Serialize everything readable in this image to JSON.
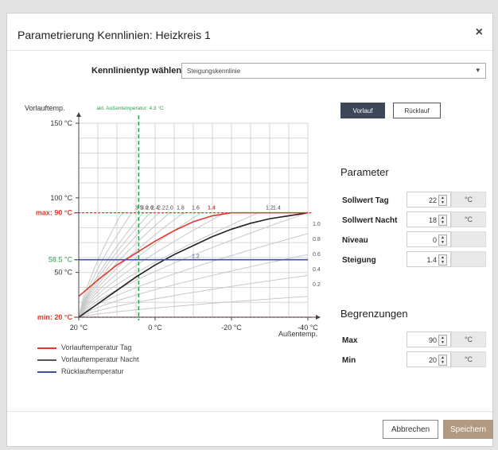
{
  "dialog": {
    "title": "Parametrierung Kennlinien: Heizkreis 1",
    "close_glyph": "×"
  },
  "curve_type": {
    "label": "Kennlinientyp wählen",
    "selected": "Steigungskennlinie"
  },
  "mode_buttons": {
    "vorlauf": "Vorlauf",
    "ruecklauf": "Rücklauf",
    "active": "vorlauf"
  },
  "parameters": {
    "title": "Parameter",
    "rows": [
      {
        "label": "Sollwert Tag",
        "value": "22",
        "unit": "°C"
      },
      {
        "label": "Sollwert Nacht",
        "value": "18",
        "unit": "°C"
      },
      {
        "label": "Niveau",
        "value": "0",
        "unit": ""
      },
      {
        "label": "Steigung",
        "value": "1.4",
        "unit": ""
      }
    ]
  },
  "limits": {
    "title": "Begrenzungen",
    "rows": [
      {
        "label": "Max",
        "value": "90",
        "unit": "°C"
      },
      {
        "label": "Min",
        "value": "20",
        "unit": "°C"
      }
    ]
  },
  "footer": {
    "cancel": "Abbrechen",
    "save": "Speichern"
  },
  "legend": [
    {
      "label": "Vorlauftemperatur Tag",
      "color": "#e03a2c"
    },
    {
      "label": "Vorlauftemperatur Nacht",
      "color": "#555555"
    },
    {
      "label": "Rücklauftemperatur",
      "color": "#3f4fa6"
    }
  ],
  "colors": {
    "day": "#e03a2c",
    "night": "#222222",
    "return": "#3f4fa6",
    "outside": "#2e9e4e",
    "limit": "#e03a2c",
    "grid": "#d6d6d6",
    "family": "#c8c8c8"
  },
  "chart_data": {
    "type": "line",
    "ylabel": "Vorlauftemp.",
    "xlabel": "Außentemp.",
    "xlim": [
      20,
      -40
    ],
    "ylim": [
      20,
      150
    ],
    "x_ticks": [
      20,
      0,
      -20,
      -40
    ],
    "x_tick_labels": [
      "20 °C",
      "0 °C",
      "-20 °C",
      "-40 °C"
    ],
    "y_ticks": [
      {
        "value": 150,
        "label": "150 °C",
        "kind": "normal"
      },
      {
        "value": 100,
        "label": "100 °C",
        "kind": "normal"
      },
      {
        "value": 90,
        "label": "max: 90 °C",
        "kind": "max"
      },
      {
        "value": 58.5,
        "label": "58.5 °C",
        "kind": "current"
      },
      {
        "value": 50,
        "label": "50 °C",
        "kind": "normal"
      },
      {
        "value": 20,
        "label": "min: 20 °C",
        "kind": "min"
      }
    ],
    "outside_temp": {
      "value": 4.3,
      "label": "akt. Außentemperatur: 4.3 °C"
    },
    "family_labels_top": [
      "3.5",
      "3.0",
      "2.6",
      "2.4",
      "2.2",
      "2.0",
      "1.8",
      "1.6",
      "1.4",
      "1.2",
      "1.4"
    ],
    "family_labels_right": [
      "1.0",
      "0.8",
      "0.6",
      "0.4",
      "0.2"
    ],
    "family_slopes": [
      3.5,
      3.0,
      2.6,
      2.4,
      2.2,
      2.0,
      1.8,
      1.6,
      1.4,
      1.2,
      1.0,
      0.8,
      0.6,
      0.4,
      0.2
    ],
    "return_label": "1.2",
    "series": [
      {
        "name": "Vorlauftemperatur Tag",
        "x": [
          20,
          15,
          10,
          5,
          0,
          -5,
          -10,
          -15,
          -20
        ],
        "y": [
          34,
          45,
          55,
          63,
          71,
          78,
          84,
          88,
          90
        ]
      },
      {
        "name": "Vorlauftemperatur Nacht",
        "x": [
          20,
          15,
          10,
          5,
          0,
          -5,
          -10,
          -15,
          -20,
          -25,
          -30,
          -35,
          -40
        ],
        "y": [
          20,
          29,
          38,
          47,
          55,
          62,
          68,
          74,
          79,
          83,
          86,
          88,
          90
        ]
      },
      {
        "name": "Rücklauftemperatur",
        "x": [
          20,
          -40
        ],
        "y": [
          58.5,
          58.5
        ]
      }
    ]
  }
}
